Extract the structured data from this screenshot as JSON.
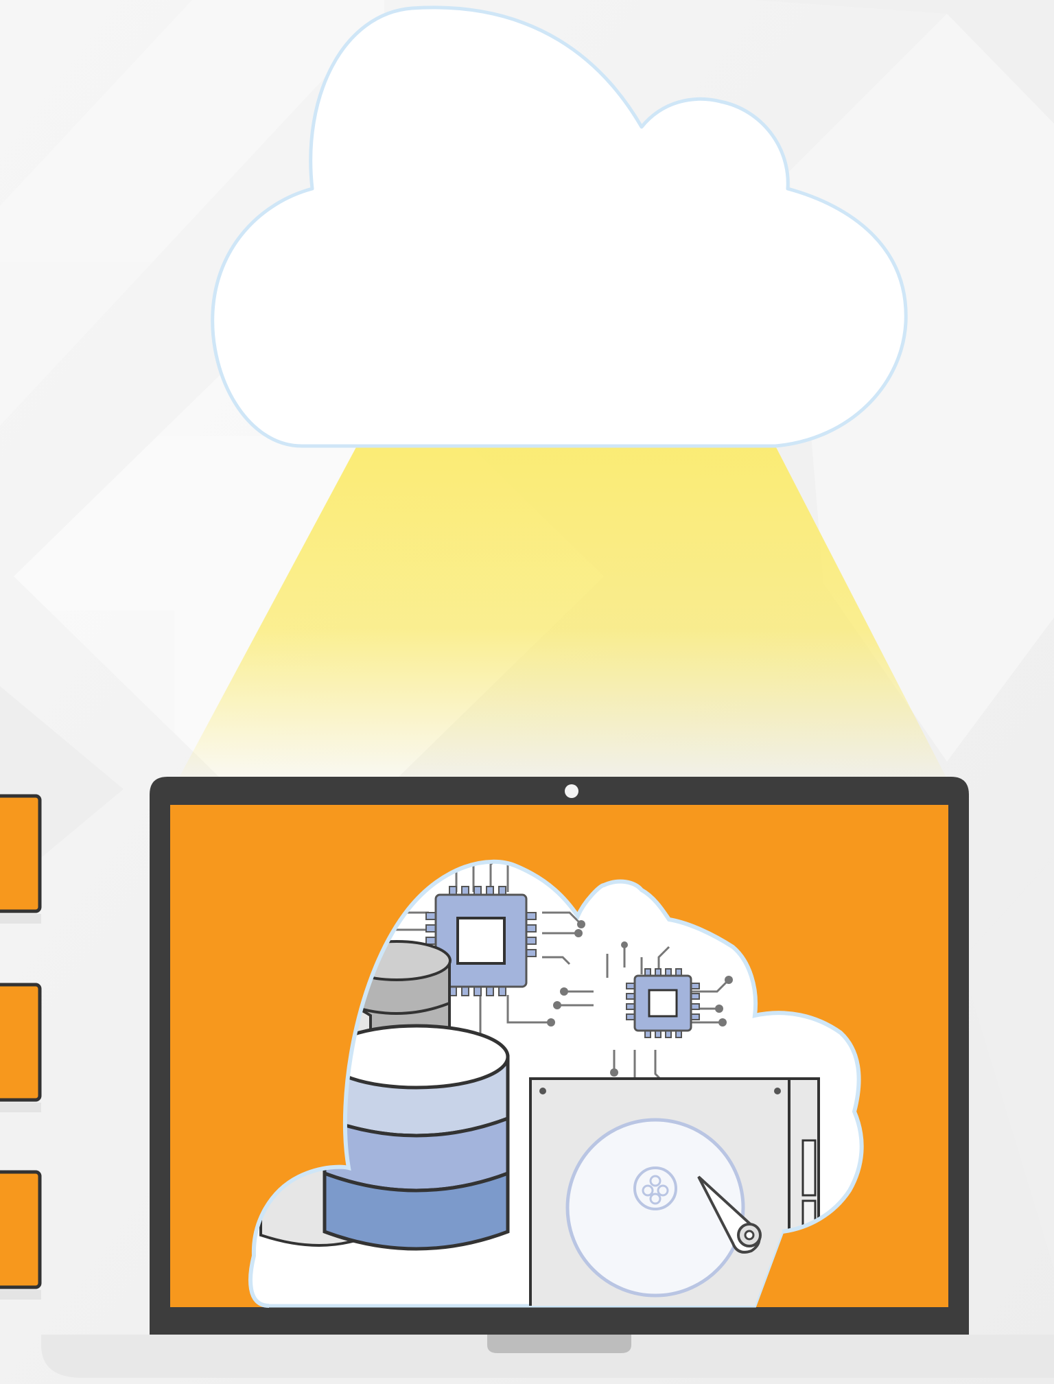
{
  "illustration": {
    "subject": "cloud-computing",
    "colors": {
      "background": "#f3f3f3",
      "cloud_fill": "#ffffff",
      "cloud_outline": "#cfe6f7",
      "light_beam": "#fbeb6e",
      "laptop_frame": "#3d3d3d",
      "laptop_screen": "#f7981d",
      "laptop_base": "#e8e8e8",
      "database_light": "#c8d3e8",
      "database_mid": "#a3b4dc",
      "database_dark": "#7c9acb",
      "chip": "#a3b4dc",
      "circuit": "#777777",
      "drive_case": "#e8e8e8",
      "drive_platter": "#b9c5e3",
      "side_device": "#f7981d"
    },
    "icons": [
      "cloud-icon",
      "laptop-icon",
      "database-icon",
      "processor-chip-icon",
      "hard-drive-icon"
    ]
  }
}
